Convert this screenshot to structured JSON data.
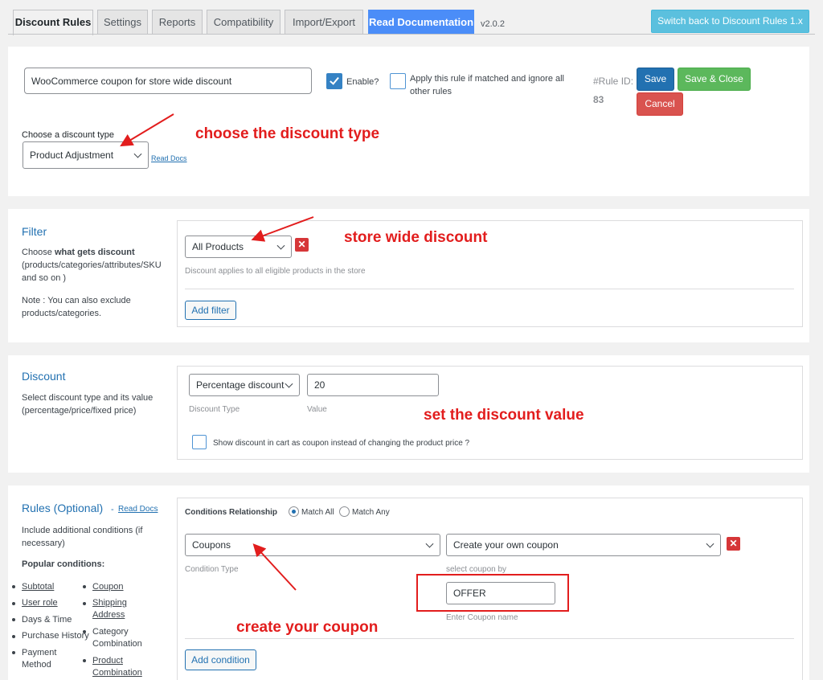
{
  "tabs": [
    {
      "label": "Discount Rules",
      "active": true
    },
    {
      "label": "Settings",
      "active": false
    },
    {
      "label": "Reports",
      "active": false
    },
    {
      "label": "Compatibility",
      "active": false
    },
    {
      "label": "Import/Export",
      "active": false
    }
  ],
  "read_documentation": "Read Documentation",
  "version": "v2.0.2",
  "switch_back": "Switch back to Discount Rules 1.x",
  "rule": {
    "title_value": "WooCommerce coupon for store wide discount",
    "enable_label": "Enable?",
    "enable_checked": true,
    "apply_line1": "Apply this rule if matched and ignore all",
    "apply_line2": "other rules",
    "apply_checked": false,
    "rule_id_label": "#Rule ID:",
    "rule_id": "83",
    "save": "Save",
    "save_close": "Save & Close",
    "cancel": "Cancel",
    "discount_type_label": "Choose a discount type",
    "discount_type_value": "Product Adjustment",
    "read_docs": "Read Docs"
  },
  "filter": {
    "title": "Filter",
    "desc_prefix": "Choose ",
    "desc_bold": "what gets discount",
    "desc_line2": "(products/categories/attributes/SKU",
    "desc_line3": "and so on )",
    "note_line1": "Note : You can also exclude",
    "note_line2": "products/categories.",
    "select_value": "All Products",
    "hint": "Discount applies to all eligible products in the store",
    "add_filter": "Add filter"
  },
  "discount": {
    "title": "Discount",
    "desc_line1": "Select discount type and its value",
    "desc_line2": "(percentage/price/fixed price)",
    "type_value": "Percentage discount",
    "value": "20",
    "type_hint": "Discount Type",
    "value_hint": "Value",
    "coupon_label": "Show discount in cart as coupon instead of changing the product price ?"
  },
  "rules": {
    "title": "Rules (Optional)",
    "dash": "-",
    "read_docs": "Read Docs",
    "desc_line1": "Include additional conditions (if",
    "desc_line2": "necessary)",
    "popular": "Popular conditions:",
    "left_list": [
      "Subtotal",
      "User role",
      "Days & Time",
      "Purchase History",
      "Payment",
      "Method"
    ],
    "right_list": [
      "Coupon",
      "Shipping",
      "Address",
      "Category",
      "Combination",
      "Product",
      "Combination"
    ],
    "conditions_relationship": "Conditions Relationship",
    "match_all": "Match All",
    "match_any": "Match Any",
    "condition_type_value": "Coupons",
    "condition_type_hint": "Condition Type",
    "coupon_mode_value": "Create your own coupon",
    "coupon_mode_hint": "select coupon by",
    "coupon_name_value": "OFFER",
    "coupon_name_hint": "Enter Coupon name",
    "add_condition": "Add condition"
  },
  "annotations": {
    "a1": "choose the discount type",
    "a2": "store wide discount",
    "a3": "set the discount value",
    "a4": "create your coupon"
  },
  "colors": {
    "annotation": "#e21d1d",
    "accent": "#2271b1"
  }
}
